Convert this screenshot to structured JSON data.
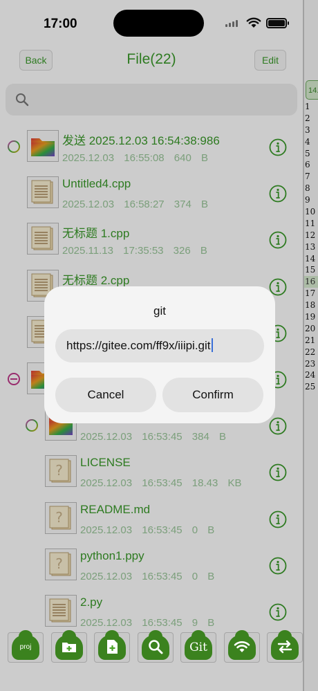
{
  "status_bar": {
    "time": "17:00"
  },
  "nav": {
    "back": "Back",
    "title": "File(22)",
    "edit": "Edit"
  },
  "search": {
    "icon": "magnifier-icon"
  },
  "files": [
    {
      "name": "发送 2025.12.03    16:54:38:986",
      "meta": "2025.12.03 16:55:08 640 B",
      "kind": "folder",
      "expander": "plus",
      "indent": 0
    },
    {
      "name": "Untitled4.cpp",
      "meta": "2025.12.03 16:58:27 374 B",
      "kind": "doc",
      "expander": "",
      "indent": 0
    },
    {
      "name": "无标题 1.cpp",
      "meta": "2025.11.13 17:35:53 326 B",
      "kind": "doc",
      "expander": "",
      "indent": 0
    },
    {
      "name": "无标题 2.cpp",
      "meta": "",
      "kind": "doc",
      "expander": "",
      "indent": 0
    },
    {
      "name": "",
      "meta": "",
      "kind": "doc",
      "expander": "",
      "indent": 0
    },
    {
      "name": "",
      "meta": "",
      "kind": "folder",
      "expander": "minus",
      "indent": 0
    },
    {
      "name": "",
      "meta": "2025.12.03 16:53:45 384 B",
      "kind": "folder",
      "expander": "plus",
      "indent": 1
    },
    {
      "name": "LICENSE",
      "meta": "2025.12.03 16:53:45 18.43 KB",
      "kind": "unknown",
      "expander": "",
      "indent": 1
    },
    {
      "name": "README.md",
      "meta": "2025.12.03 16:53:45 0 B",
      "kind": "unknown",
      "expander": "",
      "indent": 1
    },
    {
      "name": "python1.ppy",
      "meta": "2025.12.03 16:53:45 0 B",
      "kind": "unknown",
      "expander": "",
      "indent": 1
    },
    {
      "name": "2.py",
      "meta": "2025.12.03 16:53:45 9 B",
      "kind": "doc",
      "expander": "",
      "indent": 1
    }
  ],
  "toolbar": [
    {
      "name": "new-project-button",
      "label": "proj",
      "icon": "new-project-icon"
    },
    {
      "name": "new-folder-button",
      "label": "",
      "icon": "add-folder-icon"
    },
    {
      "name": "new-file-button",
      "label": "",
      "icon": "add-file-icon"
    },
    {
      "name": "search-button",
      "label": "",
      "icon": "search-icon"
    },
    {
      "name": "git-button",
      "label": "Git",
      "icon": "git-icon"
    },
    {
      "name": "wifi-button",
      "label": "",
      "icon": "wifi-share-icon"
    },
    {
      "name": "transfer-button",
      "label": "",
      "icon": "transfer-icon"
    }
  ],
  "side_panel": {
    "tab_label": "14.",
    "line_numbers": [
      "1",
      "2",
      "3",
      "4",
      "5",
      "6",
      "7",
      "8",
      "9",
      "10",
      "11",
      "12",
      "13",
      "14",
      "15",
      "16",
      "17",
      "18",
      "19",
      "20",
      "21",
      "22",
      "23",
      "24",
      "25"
    ],
    "active_line": "16"
  },
  "dialog": {
    "title": "git",
    "input_value": "https://gitee.com/ff9x/iiipi.git",
    "cancel": "Cancel",
    "confirm": "Confirm"
  },
  "colors": {
    "accent": "#3a9a2a",
    "meta": "#9ac79a",
    "toolbar_green": "#4aa326"
  }
}
